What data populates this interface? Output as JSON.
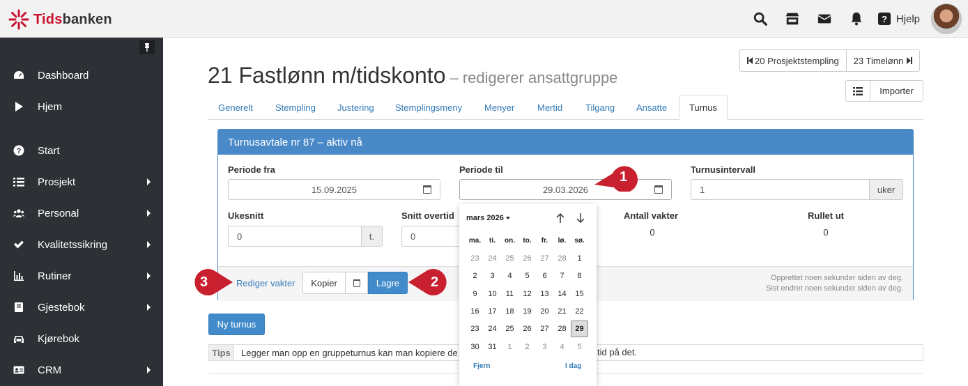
{
  "brand": {
    "name_red": "Tids",
    "name_dark": "banken"
  },
  "topbar": {
    "help_label": "Hjelp"
  },
  "sidebar": {
    "items": [
      {
        "label": "Dashboard",
        "icon": "dashboard-icon",
        "submenu": false
      },
      {
        "label": "Hjem",
        "icon": "play-icon",
        "submenu": false
      },
      {
        "label": "Start",
        "icon": "question-circle-icon",
        "submenu": false
      },
      {
        "label": "Prosjekt",
        "icon": "list-icon",
        "submenu": true
      },
      {
        "label": "Personal",
        "icon": "users-icon",
        "submenu": true
      },
      {
        "label": "Kvalitetssikring",
        "icon": "check-icon",
        "submenu": true
      },
      {
        "label": "Rutiner",
        "icon": "bar-chart-icon",
        "submenu": true
      },
      {
        "label": "Gjestebok",
        "icon": "book-icon",
        "submenu": true
      },
      {
        "label": "Kjørebok",
        "icon": "car-icon",
        "submenu": false
      },
      {
        "label": "CRM",
        "icon": "id-card-icon",
        "submenu": true
      }
    ]
  },
  "header": {
    "title": "21 Fastlønn m/tidskonto",
    "subtitle": "– redigerer ansattgruppe",
    "prev_label": "20 Prosjektstempling",
    "next_label": "23 Timelønn",
    "import_label": "Importer"
  },
  "tabs": [
    "Generelt",
    "Stempling",
    "Justering",
    "Stemplingsmeny",
    "Menyer",
    "Mertid",
    "Tilgang",
    "Ansatte",
    "Turnus"
  ],
  "active_tab": "Turnus",
  "panel": {
    "title": "Turnusavtale nr 87 – aktiv nå",
    "periode_fra_label": "Periode fra",
    "periode_fra_value": "15.09.2025",
    "periode_til_label": "Periode til",
    "periode_til_value": "29.03.2026",
    "turnusintervall_label": "Turnusintervall",
    "turnusintervall_value": "1",
    "turnusintervall_unit": "uker",
    "ukesnitt_label": "Ukesnitt",
    "ukesnitt_value": "0",
    "ukesnitt_unit": "t.",
    "snitt_label": "Snitt overtid",
    "snitt_value": "0",
    "antall_label": "Antall vakter",
    "antall_value": "0",
    "rullet_label": "Rullet ut",
    "rullet_value": "0",
    "created_note": "Opprettet noen sekunder siden av deg.",
    "edited_note": "Sist endret noen sekunder siden av deg.",
    "edit_link": "Rediger vakter",
    "copy_label": "Kopier",
    "save_label": "Lagre"
  },
  "new_turnus_label": "Ny turnus",
  "tips": {
    "label": "Tips",
    "text": "Legger man opp en gruppeturnus kan man kopiere de",
    "text_end": "tid på det."
  },
  "datepicker": {
    "month": "mars 2026",
    "weekdays": [
      "ma.",
      "ti.",
      "on.",
      "to.",
      "fr.",
      "lø.",
      "sø."
    ],
    "weeks": [
      [
        "23",
        "24",
        "25",
        "26",
        "27",
        "28",
        "1"
      ],
      [
        "2",
        "3",
        "4",
        "5",
        "6",
        "7",
        "8"
      ],
      [
        "9",
        "10",
        "11",
        "12",
        "13",
        "14",
        "15"
      ],
      [
        "16",
        "17",
        "18",
        "19",
        "20",
        "21",
        "22"
      ],
      [
        "23",
        "24",
        "25",
        "26",
        "27",
        "28",
        "29"
      ],
      [
        "30",
        "31",
        "1",
        "2",
        "3",
        "4",
        "5"
      ]
    ],
    "muted": [
      [
        0,
        0
      ],
      [
        0,
        1
      ],
      [
        0,
        2
      ],
      [
        0,
        3
      ],
      [
        0,
        4
      ],
      [
        0,
        5
      ],
      [
        5,
        2
      ],
      [
        5,
        3
      ],
      [
        5,
        4
      ],
      [
        5,
        5
      ],
      [
        5,
        6
      ]
    ],
    "selected": [
      4,
      6
    ],
    "clear_label": "Fjern",
    "today_label": "I dag"
  },
  "callouts": [
    "1",
    "2",
    "3"
  ],
  "colors": {
    "primary": "#428bca",
    "panel_head": "#4a89c8",
    "sidebar": "#2d3035",
    "callout": "#c8202f"
  }
}
